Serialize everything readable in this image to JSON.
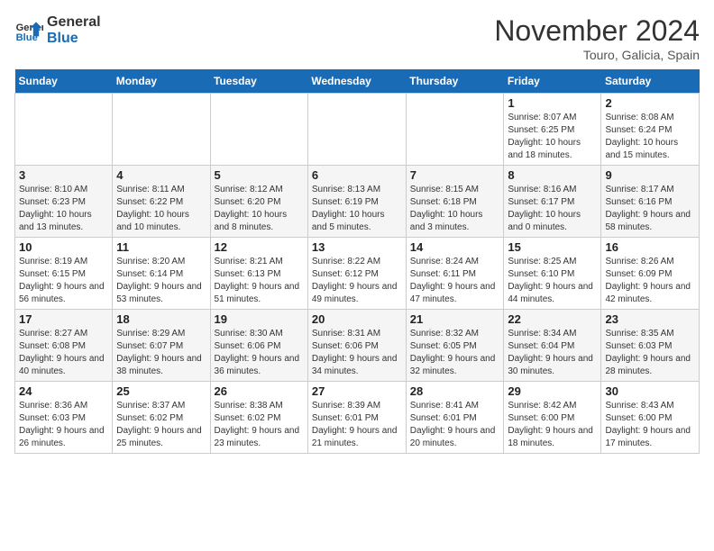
{
  "logo": {
    "line1": "General",
    "line2": "Blue"
  },
  "title": "November 2024",
  "subtitle": "Touro, Galicia, Spain",
  "days_header": [
    "Sunday",
    "Monday",
    "Tuesday",
    "Wednesday",
    "Thursday",
    "Friday",
    "Saturday"
  ],
  "weeks": [
    [
      {
        "day": "",
        "info": ""
      },
      {
        "day": "",
        "info": ""
      },
      {
        "day": "",
        "info": ""
      },
      {
        "day": "",
        "info": ""
      },
      {
        "day": "",
        "info": ""
      },
      {
        "day": "1",
        "info": "Sunrise: 8:07 AM\nSunset: 6:25 PM\nDaylight: 10 hours and 18 minutes."
      },
      {
        "day": "2",
        "info": "Sunrise: 8:08 AM\nSunset: 6:24 PM\nDaylight: 10 hours and 15 minutes."
      }
    ],
    [
      {
        "day": "3",
        "info": "Sunrise: 8:10 AM\nSunset: 6:23 PM\nDaylight: 10 hours and 13 minutes."
      },
      {
        "day": "4",
        "info": "Sunrise: 8:11 AM\nSunset: 6:22 PM\nDaylight: 10 hours and 10 minutes."
      },
      {
        "day": "5",
        "info": "Sunrise: 8:12 AM\nSunset: 6:20 PM\nDaylight: 10 hours and 8 minutes."
      },
      {
        "day": "6",
        "info": "Sunrise: 8:13 AM\nSunset: 6:19 PM\nDaylight: 10 hours and 5 minutes."
      },
      {
        "day": "7",
        "info": "Sunrise: 8:15 AM\nSunset: 6:18 PM\nDaylight: 10 hours and 3 minutes."
      },
      {
        "day": "8",
        "info": "Sunrise: 8:16 AM\nSunset: 6:17 PM\nDaylight: 10 hours and 0 minutes."
      },
      {
        "day": "9",
        "info": "Sunrise: 8:17 AM\nSunset: 6:16 PM\nDaylight: 9 hours and 58 minutes."
      }
    ],
    [
      {
        "day": "10",
        "info": "Sunrise: 8:19 AM\nSunset: 6:15 PM\nDaylight: 9 hours and 56 minutes."
      },
      {
        "day": "11",
        "info": "Sunrise: 8:20 AM\nSunset: 6:14 PM\nDaylight: 9 hours and 53 minutes."
      },
      {
        "day": "12",
        "info": "Sunrise: 8:21 AM\nSunset: 6:13 PM\nDaylight: 9 hours and 51 minutes."
      },
      {
        "day": "13",
        "info": "Sunrise: 8:22 AM\nSunset: 6:12 PM\nDaylight: 9 hours and 49 minutes."
      },
      {
        "day": "14",
        "info": "Sunrise: 8:24 AM\nSunset: 6:11 PM\nDaylight: 9 hours and 47 minutes."
      },
      {
        "day": "15",
        "info": "Sunrise: 8:25 AM\nSunset: 6:10 PM\nDaylight: 9 hours and 44 minutes."
      },
      {
        "day": "16",
        "info": "Sunrise: 8:26 AM\nSunset: 6:09 PM\nDaylight: 9 hours and 42 minutes."
      }
    ],
    [
      {
        "day": "17",
        "info": "Sunrise: 8:27 AM\nSunset: 6:08 PM\nDaylight: 9 hours and 40 minutes."
      },
      {
        "day": "18",
        "info": "Sunrise: 8:29 AM\nSunset: 6:07 PM\nDaylight: 9 hours and 38 minutes."
      },
      {
        "day": "19",
        "info": "Sunrise: 8:30 AM\nSunset: 6:06 PM\nDaylight: 9 hours and 36 minutes."
      },
      {
        "day": "20",
        "info": "Sunrise: 8:31 AM\nSunset: 6:06 PM\nDaylight: 9 hours and 34 minutes."
      },
      {
        "day": "21",
        "info": "Sunrise: 8:32 AM\nSunset: 6:05 PM\nDaylight: 9 hours and 32 minutes."
      },
      {
        "day": "22",
        "info": "Sunrise: 8:34 AM\nSunset: 6:04 PM\nDaylight: 9 hours and 30 minutes."
      },
      {
        "day": "23",
        "info": "Sunrise: 8:35 AM\nSunset: 6:03 PM\nDaylight: 9 hours and 28 minutes."
      }
    ],
    [
      {
        "day": "24",
        "info": "Sunrise: 8:36 AM\nSunset: 6:03 PM\nDaylight: 9 hours and 26 minutes."
      },
      {
        "day": "25",
        "info": "Sunrise: 8:37 AM\nSunset: 6:02 PM\nDaylight: 9 hours and 25 minutes."
      },
      {
        "day": "26",
        "info": "Sunrise: 8:38 AM\nSunset: 6:02 PM\nDaylight: 9 hours and 23 minutes."
      },
      {
        "day": "27",
        "info": "Sunrise: 8:39 AM\nSunset: 6:01 PM\nDaylight: 9 hours and 21 minutes."
      },
      {
        "day": "28",
        "info": "Sunrise: 8:41 AM\nSunset: 6:01 PM\nDaylight: 9 hours and 20 minutes."
      },
      {
        "day": "29",
        "info": "Sunrise: 8:42 AM\nSunset: 6:00 PM\nDaylight: 9 hours and 18 minutes."
      },
      {
        "day": "30",
        "info": "Sunrise: 8:43 AM\nSunset: 6:00 PM\nDaylight: 9 hours and 17 minutes."
      }
    ]
  ]
}
